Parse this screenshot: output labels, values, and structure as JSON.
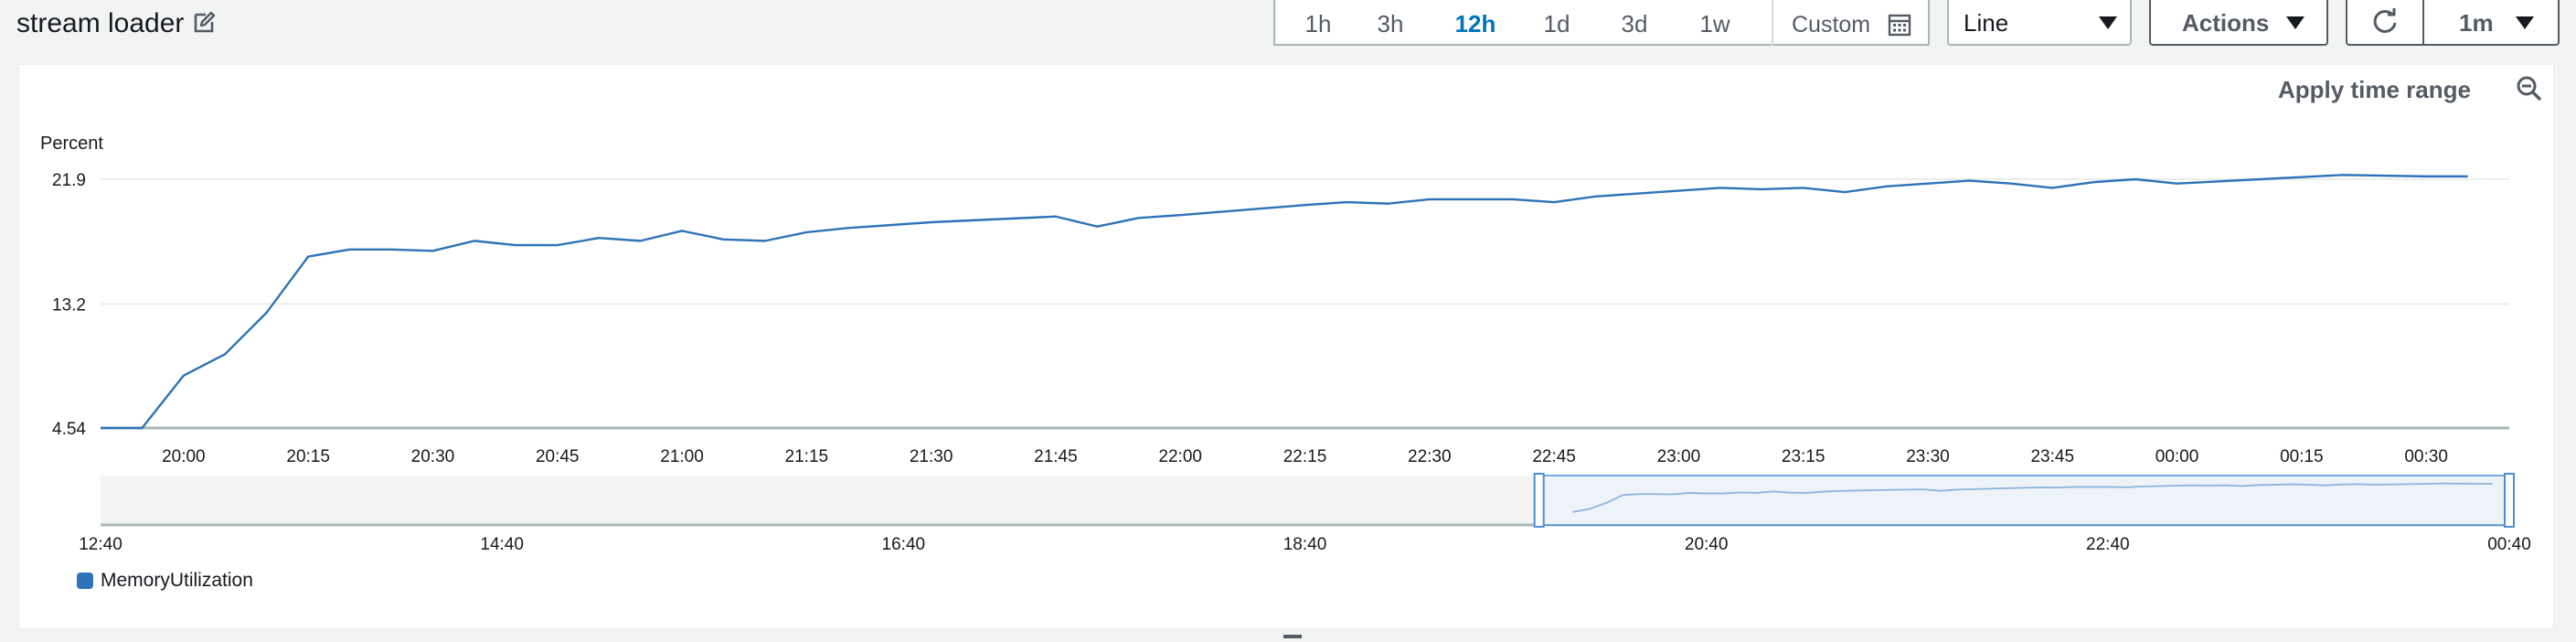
{
  "header": {
    "title": "stream loader"
  },
  "toolbar": {
    "ranges": [
      "1h",
      "3h",
      "12h",
      "1d",
      "3d",
      "1w"
    ],
    "active_range": "12h",
    "custom_label": "Custom",
    "view_select": "Line",
    "actions_label": "Actions",
    "refresh_interval": "1m"
  },
  "panel": {
    "apply_time_range": "Apply time range"
  },
  "colors": {
    "series": "#2e73b8",
    "active": "#0073bb"
  },
  "chart_data": {
    "type": "line",
    "ylabel": "Percent",
    "y_ticks": [
      "4.54",
      "13.2",
      "21.9"
    ],
    "ylim": [
      4.54,
      21.9
    ],
    "x_ticks": [
      "20:00",
      "20:15",
      "20:30",
      "20:45",
      "21:00",
      "21:15",
      "21:30",
      "21:45",
      "22:00",
      "22:15",
      "22:30",
      "22:45",
      "23:00",
      "23:15",
      "23:30",
      "23:45",
      "00:00",
      "00:15",
      "00:30"
    ],
    "x_start": "19:50",
    "x_end": "00:40",
    "grid": true,
    "legend_position": "bottom-left",
    "series": [
      {
        "name": "MemoryUtilization",
        "x": [
          "19:45",
          "19:50",
          "19:55",
          "20:00",
          "20:05",
          "20:10",
          "20:15",
          "20:20",
          "20:25",
          "20:30",
          "20:35",
          "20:40",
          "20:45",
          "20:50",
          "20:55",
          "21:00",
          "21:05",
          "21:10",
          "21:15",
          "21:20",
          "21:30",
          "21:45",
          "21:50",
          "21:55",
          "22:00",
          "22:15",
          "22:20",
          "22:25",
          "22:30",
          "22:40",
          "22:45",
          "22:50",
          "23:00",
          "23:05",
          "23:10",
          "23:15",
          "23:20",
          "23:25",
          "23:35",
          "23:40",
          "23:45",
          "23:50",
          "23:55",
          "00:00",
          "00:10",
          "00:20",
          "00:30",
          "00:35"
        ],
        "values": [
          4.54,
          4.54,
          4.54,
          8.2,
          9.7,
          12.6,
          16.5,
          17.0,
          17.0,
          16.9,
          17.6,
          17.3,
          17.3,
          17.8,
          17.6,
          18.3,
          17.7,
          17.6,
          18.2,
          18.5,
          18.9,
          19.3,
          18.6,
          19.2,
          19.4,
          20.1,
          20.3,
          20.2,
          20.5,
          20.5,
          20.3,
          20.7,
          21.1,
          21.3,
          21.2,
          21.3,
          21.0,
          21.4,
          21.8,
          21.6,
          21.3,
          21.7,
          21.9,
          21.6,
          21.9,
          22.2,
          22.1,
          22.1
        ]
      }
    ],
    "navigator": {
      "x_ticks": [
        "12:40",
        "14:40",
        "16:40",
        "18:40",
        "20:40",
        "22:40",
        "00:40"
      ],
      "selection_start": "19:50",
      "selection_end": "00:40"
    },
    "legend": [
      "MemoryUtilization"
    ]
  }
}
